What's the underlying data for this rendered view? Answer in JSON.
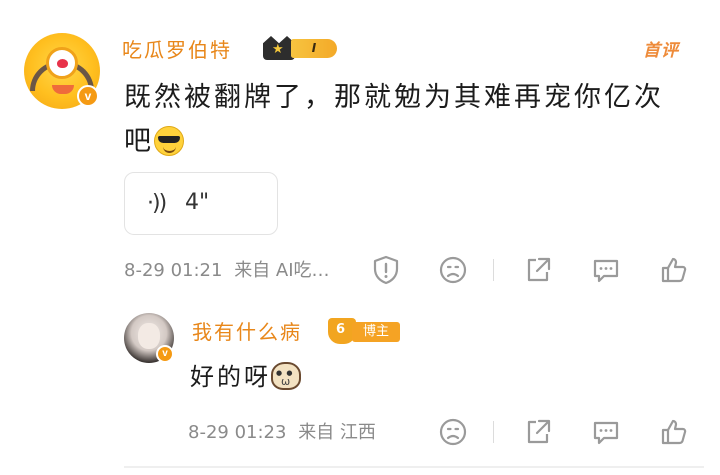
{
  "comment": {
    "username": "吃瓜罗伯特",
    "level_badge": "I",
    "first_comment_tag": "首评",
    "text": "既然被翻牌了，那就勉为其难再宠你亿次吧",
    "emoji": "cool-sunglasses-emoji",
    "voice": {
      "icon": "·))",
      "duration": "4\""
    },
    "time": "8-29 01:21",
    "source": "来自 AI吃…"
  },
  "reply": {
    "username": "我有什么病",
    "badge_label": "博主",
    "text": "好的呀",
    "emoji": "cat-emoji",
    "time": "8-29 01:23",
    "source": "来自 江西"
  },
  "colors": {
    "username": "#e8871a",
    "accent_orange": "#f59a13",
    "meta_gray": "#8a8a8a",
    "icon_gray": "#9a9a9a"
  },
  "icons": [
    "warning-shield-icon",
    "frown-face-icon",
    "share-icon",
    "comment-icon",
    "thumb-up-icon"
  ]
}
